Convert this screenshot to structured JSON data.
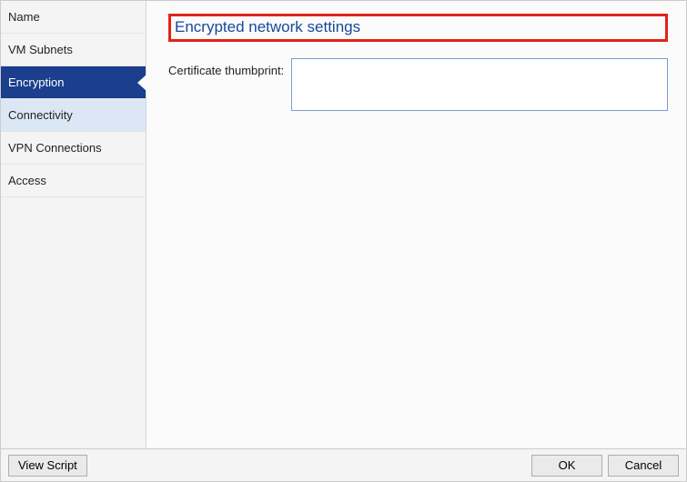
{
  "sidebar": {
    "items": [
      {
        "label": "Name"
      },
      {
        "label": "VM Subnets"
      },
      {
        "label": "Encryption"
      },
      {
        "label": "Connectivity"
      },
      {
        "label": "VPN Connections"
      },
      {
        "label": "Access"
      }
    ],
    "selected_index": 2,
    "hover_index": 3
  },
  "panel": {
    "title": "Encrypted network settings",
    "cert_label": "Certificate thumbprint:",
    "cert_value": ""
  },
  "footer": {
    "view_script": "View Script",
    "ok": "OK",
    "cancel": "Cancel"
  }
}
